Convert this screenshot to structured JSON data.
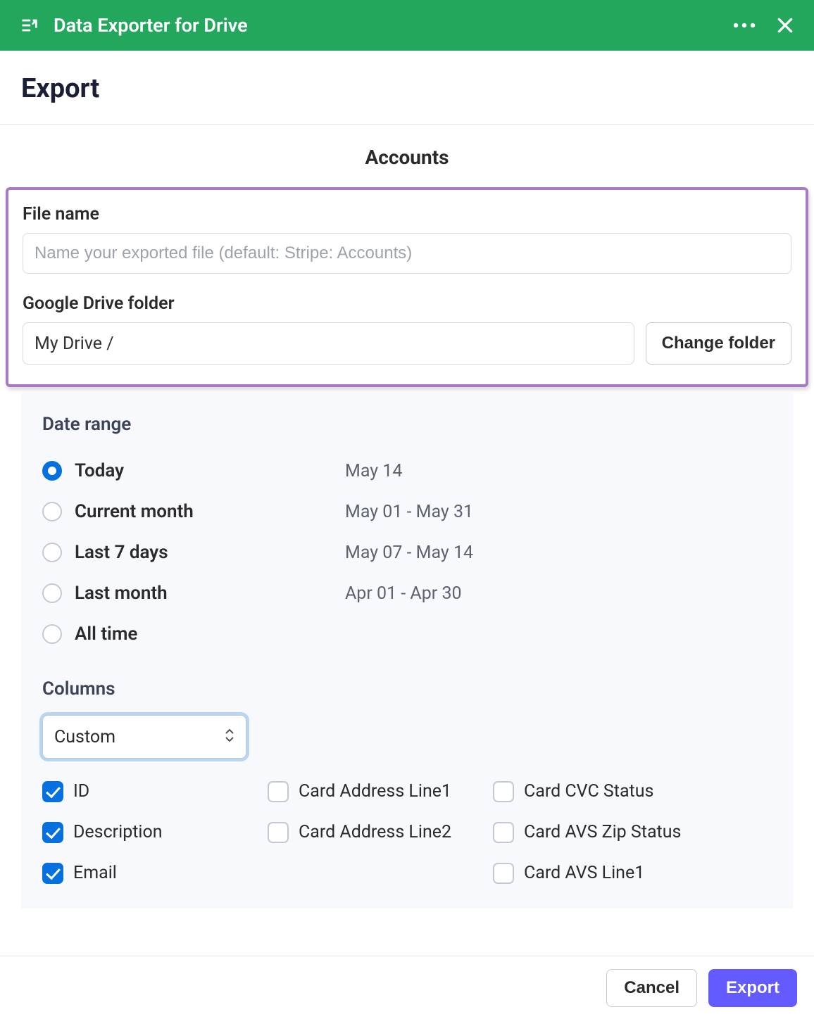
{
  "header": {
    "title": "Data Exporter for Drive"
  },
  "page_title": "Export",
  "section_title": "Accounts",
  "file_name": {
    "label": "File name",
    "placeholder": "Name your exported file (default: Stripe: Accounts)",
    "value": ""
  },
  "drive_folder": {
    "label": "Google Drive folder",
    "value": "My Drive /",
    "change_label": "Change folder"
  },
  "date_range": {
    "heading": "Date range",
    "options": [
      {
        "label": "Today",
        "range": "May 14",
        "selected": true
      },
      {
        "label": "Current month",
        "range": "May 01 - May 31",
        "selected": false
      },
      {
        "label": "Last 7 days",
        "range": "May 07 - May 14",
        "selected": false
      },
      {
        "label": "Last month",
        "range": "Apr 01 - Apr 30",
        "selected": false
      },
      {
        "label": "All time",
        "range": "",
        "selected": false
      }
    ]
  },
  "columns": {
    "heading": "Columns",
    "selected_preset": "Custom",
    "col1": [
      {
        "label": "ID",
        "checked": true
      },
      {
        "label": "Description",
        "checked": true
      },
      {
        "label": "Email",
        "checked": true
      }
    ],
    "col2": [
      {
        "label": "Card Address Line1",
        "checked": false
      },
      {
        "label": "Card Address Line2",
        "checked": false
      }
    ],
    "col3": [
      {
        "label": "Card CVC Status",
        "checked": false
      },
      {
        "label": "Card AVS Zip Status",
        "checked": false
      },
      {
        "label": "Card AVS Line1",
        "checked": false
      }
    ]
  },
  "footer": {
    "cancel": "Cancel",
    "export": "Export"
  }
}
